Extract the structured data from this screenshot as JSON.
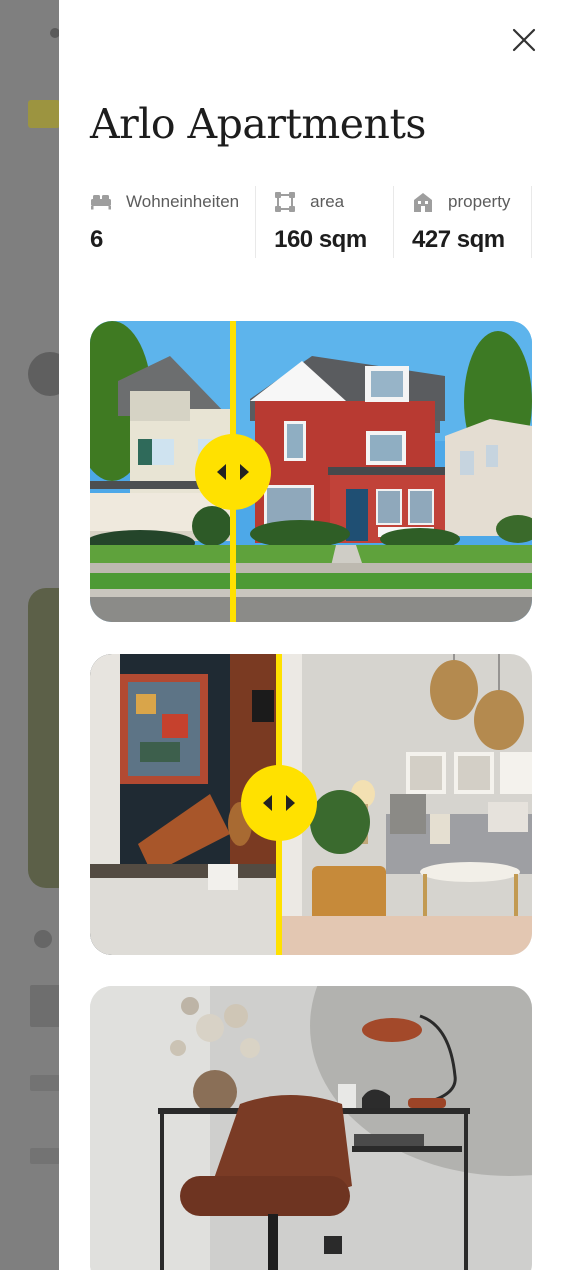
{
  "property": {
    "title": "Arlo Apartments",
    "stats": [
      {
        "icon": "bed-icon",
        "label": "Wohneinheiten",
        "value": "6"
      },
      {
        "icon": "area-icon",
        "label": "area",
        "value": "160 sqm"
      },
      {
        "icon": "building-icon",
        "label": "property",
        "value": "427 sqm"
      }
    ]
  },
  "colors": {
    "accent": "#ffe100",
    "overlay": "#7f7f7f"
  },
  "images": [
    {
      "alt": "before-after comparison slider of house exterior"
    },
    {
      "alt": "before-after comparison slider of living room"
    },
    {
      "alt": "home office desk with chair and lamp"
    }
  ]
}
